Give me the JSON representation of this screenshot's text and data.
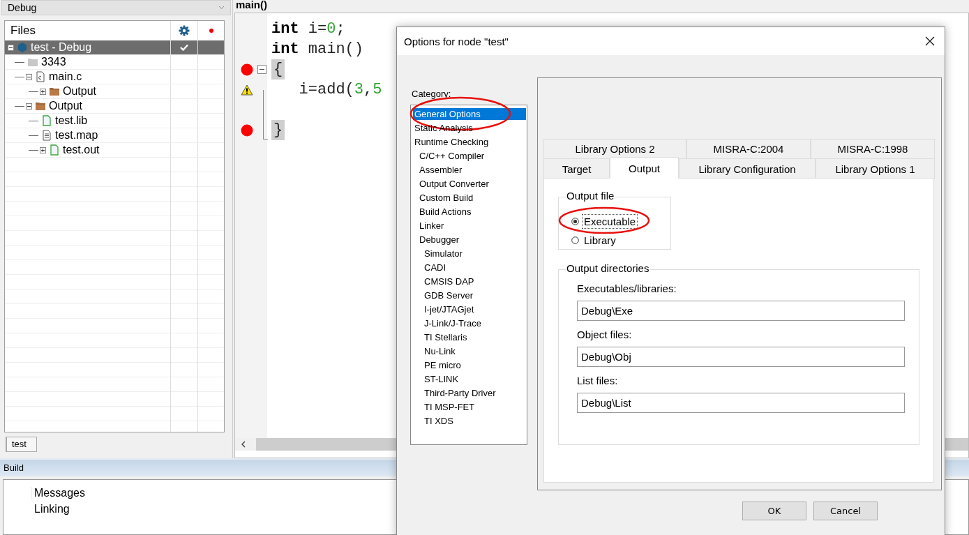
{
  "configuration": {
    "value": "Debug"
  },
  "files": {
    "header": "Files",
    "tree": [
      {
        "label": "test - Debug",
        "kind": "project",
        "selected": true,
        "expanded": true,
        "checked": true,
        "children": [
          {
            "label": "3343",
            "kind": "group",
            "selected": false
          },
          {
            "label": "main.c",
            "kind": "c-file",
            "selected": false,
            "expanded": true,
            "children": [
              {
                "label": "Output",
                "kind": "folder",
                "selected": false,
                "expanded": false
              }
            ]
          },
          {
            "label": "Output",
            "kind": "folder",
            "selected": false,
            "expanded": true,
            "children": [
              {
                "label": "test.lib",
                "kind": "file",
                "selected": false
              },
              {
                "label": "test.map",
                "kind": "text-file",
                "selected": false
              },
              {
                "label": "test.out",
                "kind": "file",
                "selected": false,
                "expanded": false
              }
            ]
          }
        ]
      }
    ]
  },
  "workspace_tab": {
    "label": "test"
  },
  "editor": {
    "tab": "main()",
    "lines": [
      {
        "breakpoint": false,
        "warning": false,
        "tokens": [
          {
            "kind": "keyword",
            "text": "int"
          },
          {
            "kind": "plain",
            "text": " i="
          },
          {
            "kind": "number",
            "text": "0"
          },
          {
            "kind": "plain",
            "text": ";"
          }
        ]
      },
      {
        "breakpoint": false,
        "warning": false,
        "tokens": [
          {
            "kind": "keyword",
            "text": "int"
          },
          {
            "kind": "plain",
            "text": " main()"
          }
        ]
      },
      {
        "breakpoint": true,
        "warning": false,
        "fold": true,
        "tokens": [
          {
            "kind": "brace",
            "text": "{"
          }
        ]
      },
      {
        "breakpoint": false,
        "warning": true,
        "tokens": [
          {
            "kind": "plain",
            "text": "   i=add("
          },
          {
            "kind": "number",
            "text": "3"
          },
          {
            "kind": "plain",
            "text": ","
          },
          {
            "kind": "number",
            "text": "5"
          }
        ]
      },
      {
        "breakpoint": false,
        "warning": false
      },
      {
        "breakpoint": true,
        "warning": false,
        "tokens": [
          {
            "kind": "brace",
            "text": "}"
          }
        ]
      }
    ]
  },
  "build": {
    "title": "Build",
    "column": "Messages",
    "messages": [
      "Linking"
    ]
  },
  "dialog": {
    "title": "Options for node \"test\"",
    "category_label": "Category:",
    "categories": [
      {
        "label": "General Options",
        "selected": true,
        "circled": true
      },
      {
        "label": "Static Analysis",
        "selected": false
      },
      {
        "label": "Runtime Checking",
        "selected": false,
        "children": [
          {
            "label": "C/C++ Compiler",
            "selected": false
          },
          {
            "label": "Assembler",
            "selected": false
          },
          {
            "label": "Output Converter",
            "selected": false
          },
          {
            "label": "Custom Build",
            "selected": false
          },
          {
            "label": "Build Actions",
            "selected": false
          },
          {
            "label": "Linker",
            "selected": false
          },
          {
            "label": "Debugger",
            "selected": false,
            "children": [
              {
                "label": "Simulator",
                "selected": false
              },
              {
                "label": "CADI",
                "selected": false
              },
              {
                "label": "CMSIS DAP",
                "selected": false
              },
              {
                "label": "GDB Server",
                "selected": false
              },
              {
                "label": "I-jet/JTAGjet",
                "selected": false
              },
              {
                "label": "J-Link/J-Trace",
                "selected": false
              },
              {
                "label": "TI Stellaris",
                "selected": false
              },
              {
                "label": "Nu-Link",
                "selected": false
              },
              {
                "label": "PE micro",
                "selected": false
              },
              {
                "label": "ST-LINK",
                "selected": false
              },
              {
                "label": "Third-Party Driver",
                "selected": false
              },
              {
                "label": "TI MSP-FET",
                "selected": false
              },
              {
                "label": "TI XDS",
                "selected": false
              }
            ]
          }
        ]
      }
    ],
    "tab_rows": [
      [
        {
          "label": "Library Options 2",
          "selected": false
        },
        {
          "label": "MISRA-C:2004",
          "selected": false
        },
        {
          "label": "MISRA-C:1998",
          "selected": false
        }
      ],
      [
        {
          "label": "Target",
          "selected": false
        },
        {
          "label": "Output",
          "selected": true
        },
        {
          "label": "Library Configuration",
          "selected": false
        },
        {
          "label": "Library Options 1",
          "selected": false
        }
      ]
    ],
    "output_file": {
      "title": "Output file",
      "options": [
        {
          "label": "Executable",
          "selected": true,
          "circled": true
        },
        {
          "label": "Library",
          "selected": false
        }
      ]
    },
    "output_directories": {
      "title": "Output directories",
      "fields": [
        {
          "label": "Executables/libraries:",
          "value": "Debug\\Exe"
        },
        {
          "label": "Object files:",
          "value": "Debug\\Obj"
        },
        {
          "label": "List files:",
          "value": "Debug\\List"
        }
      ]
    },
    "buttons": [
      "OK",
      "Cancel"
    ]
  }
}
